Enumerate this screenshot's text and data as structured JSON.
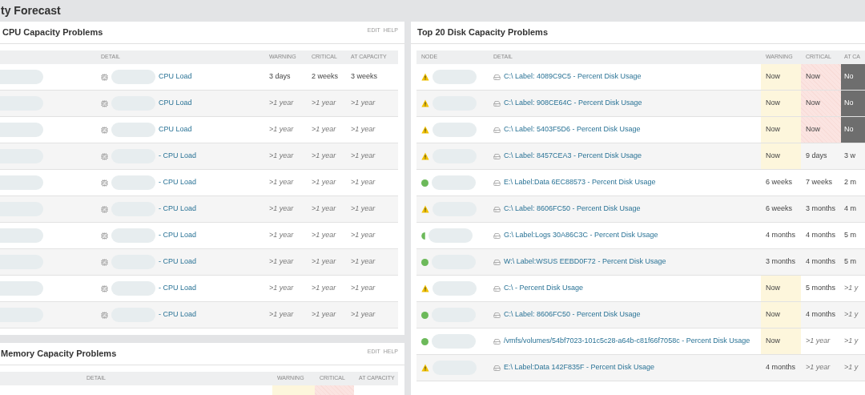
{
  "page_title": "ty Forecast",
  "cpu_panel": {
    "title": "CPU Capacity Problems",
    "actions": [
      "EDIT",
      "HELP"
    ],
    "columns": [
      "DETAIL",
      "WARNING",
      "CRITICAL",
      "AT CAPACITY"
    ],
    "rows": [
      {
        "cells": [
          {
            "text": "CPU Load"
          },
          {
            "text": "3 days",
            "flagged": false,
            "italic": false
          },
          {
            "text": "2 weeks",
            "flagged": false,
            "italic": false
          },
          {
            "text": "3 weeks",
            "flagged": false,
            "italic": false
          }
        ]
      },
      {
        "cells": [
          {
            "text": "CPU Load"
          },
          {
            "text": ">1 year",
            "flagged": false,
            "italic": true
          },
          {
            "text": ">1 year",
            "flagged": false,
            "italic": true
          },
          {
            "text": ">1 year",
            "flagged": false,
            "italic": true
          }
        ]
      },
      {
        "cells": [
          {
            "text": "CPU Load"
          },
          {
            "text": ">1 year",
            "flagged": false,
            "italic": true
          },
          {
            "text": ">1 year",
            "flagged": false,
            "italic": true
          },
          {
            "text": ">1 year",
            "flagged": false,
            "italic": true
          }
        ]
      },
      {
        "cells": [
          {
            "text": "- CPU Load"
          },
          {
            "text": ">1 year",
            "flagged": false,
            "italic": true
          },
          {
            "text": ">1 year",
            "flagged": false,
            "italic": true
          },
          {
            "text": ">1 year",
            "flagged": false,
            "italic": true
          }
        ]
      },
      {
        "cells": [
          {
            "text": "- CPU Load"
          },
          {
            "text": ">1 year",
            "flagged": false,
            "italic": true
          },
          {
            "text": ">1 year",
            "flagged": false,
            "italic": true
          },
          {
            "text": ">1 year",
            "flagged": false,
            "italic": true
          }
        ]
      },
      {
        "cells": [
          {
            "text": "- CPU Load"
          },
          {
            "text": ">1 year",
            "flagged": false,
            "italic": true
          },
          {
            "text": ">1 year",
            "flagged": false,
            "italic": true
          },
          {
            "text": ">1 year",
            "flagged": false,
            "italic": true
          }
        ]
      },
      {
        "cells": [
          {
            "text": "- CPU Load"
          },
          {
            "text": ">1 year",
            "flagged": false,
            "italic": true
          },
          {
            "text": ">1 year",
            "flagged": false,
            "italic": true
          },
          {
            "text": ">1 year",
            "flagged": false,
            "italic": true
          }
        ]
      },
      {
        "cells": [
          {
            "text": "- CPU Load"
          },
          {
            "text": ">1 year",
            "flagged": false,
            "italic": true
          },
          {
            "text": ">1 year",
            "flagged": false,
            "italic": true
          },
          {
            "text": ">1 year",
            "flagged": false,
            "italic": true
          }
        ]
      },
      {
        "cells": [
          {
            "text": "- CPU Load"
          },
          {
            "text": ">1 year",
            "flagged": false,
            "italic": true
          },
          {
            "text": ">1 year",
            "flagged": false,
            "italic": true
          },
          {
            "text": ">1 year",
            "flagged": false,
            "italic": true
          }
        ]
      },
      {
        "cells": [
          {
            "text": "- CPU Load"
          },
          {
            "text": ">1 year",
            "flagged": false,
            "italic": true
          },
          {
            "text": ">1 year",
            "flagged": false,
            "italic": true
          },
          {
            "text": ">1 year",
            "flagged": false,
            "italic": true
          }
        ]
      }
    ]
  },
  "memory_panel": {
    "title": "Memory Capacity Problems",
    "actions": [
      "EDIT",
      "HELP"
    ],
    "columns": [
      "DETAIL",
      "WARNING",
      "CRITICAL",
      "AT CAPACITY"
    ],
    "rows": [
      {
        "cells": [
          {
            "flagged": true
          },
          {
            "flagged": true
          },
          {
            "flagged": false
          }
        ]
      }
    ]
  },
  "disk_panel": {
    "title": "Top 20 Disk Capacity Problems",
    "columns": [
      "NODE",
      "DETAIL",
      "WARNING",
      "CRITICAL",
      "AT CA"
    ],
    "rows": [
      {
        "cells": [
          {
            "kind": "warning"
          },
          {
            "text": "C:\\ Label: 4089C9C5 - Percent Disk Usage"
          },
          {
            "text": "Now",
            "flagged": true,
            "italic": false
          },
          {
            "text": "Now",
            "flagged": true,
            "italic": false
          },
          {
            "text": "No",
            "flagged": true,
            "italic": false
          }
        ]
      },
      {
        "cells": [
          {
            "kind": "warning"
          },
          {
            "text": "C:\\ Label: 908CE64C - Percent Disk Usage"
          },
          {
            "text": "Now",
            "flagged": true,
            "italic": false
          },
          {
            "text": "Now",
            "flagged": true,
            "italic": false
          },
          {
            "text": "No",
            "flagged": true,
            "italic": false
          }
        ]
      },
      {
        "cells": [
          {
            "kind": "warning"
          },
          {
            "text": "C:\\ Label: 5403F5D6 - Percent Disk Usage"
          },
          {
            "text": "Now",
            "flagged": true,
            "italic": false
          },
          {
            "text": "Now",
            "flagged": true,
            "italic": false
          },
          {
            "text": "No",
            "flagged": true,
            "italic": false
          }
        ]
      },
      {
        "cells": [
          {
            "kind": "warning"
          },
          {
            "text": "C:\\ Label: 8457CEA3 - Percent Disk Usage"
          },
          {
            "text": "Now",
            "flagged": true,
            "italic": false
          },
          {
            "text": "9 days",
            "flagged": false,
            "italic": false
          },
          {
            "text": "3 w",
            "flagged": false,
            "italic": false
          }
        ]
      },
      {
        "cells": [
          {
            "kind": "up"
          },
          {
            "text": "E:\\ Label:Data 6EC88573 - Percent Disk Usage"
          },
          {
            "text": "6 weeks",
            "flagged": false,
            "italic": false
          },
          {
            "text": "7 weeks",
            "flagged": false,
            "italic": false
          },
          {
            "text": "2 m",
            "flagged": false,
            "italic": false
          }
        ]
      },
      {
        "cells": [
          {
            "kind": "warning"
          },
          {
            "text": "C:\\ Label: 8606FC50 - Percent Disk Usage"
          },
          {
            "text": "6 weeks",
            "flagged": false,
            "italic": false
          },
          {
            "text": "3 months",
            "flagged": false,
            "italic": false
          },
          {
            "text": "4 m",
            "flagged": false,
            "italic": false
          }
        ]
      },
      {
        "cells": [
          {
            "kind": "partial"
          },
          {
            "text": "G:\\ Label:Logs 30A86C3C - Percent Disk Usage"
          },
          {
            "text": "4 months",
            "flagged": false,
            "italic": false
          },
          {
            "text": "4 months",
            "flagged": false,
            "italic": false
          },
          {
            "text": "5 m",
            "flagged": false,
            "italic": false
          }
        ]
      },
      {
        "cells": [
          {
            "kind": "up"
          },
          {
            "text": "W:\\ Label:WSUS EEBD0F72 - Percent Disk Usage"
          },
          {
            "text": "3 months",
            "flagged": false,
            "italic": false
          },
          {
            "text": "4 months",
            "flagged": false,
            "italic": false
          },
          {
            "text": "5 m",
            "flagged": false,
            "italic": false
          }
        ]
      },
      {
        "cells": [
          {
            "kind": "warning"
          },
          {
            "text": "C:\\ - Percent Disk Usage"
          },
          {
            "text": "Now",
            "flagged": true,
            "italic": false
          },
          {
            "text": "5 months",
            "flagged": false,
            "italic": false
          },
          {
            "text": ">1 y",
            "flagged": false,
            "italic": true
          }
        ]
      },
      {
        "cells": [
          {
            "kind": "up"
          },
          {
            "text": "C:\\ Label: 8606FC50 - Percent Disk Usage"
          },
          {
            "text": "Now",
            "flagged": true,
            "italic": false
          },
          {
            "text": "4 months",
            "flagged": false,
            "italic": false
          },
          {
            "text": ">1 y",
            "flagged": false,
            "italic": true
          }
        ]
      },
      {
        "cells": [
          {
            "kind": "up"
          },
          {
            "text": "/vmfs/volumes/54bf7023-101c5c28-a64b-c81f66f7058c - Percent Disk Usage"
          },
          {
            "text": "Now",
            "flagged": true,
            "italic": false
          },
          {
            "text": ">1 year",
            "flagged": false,
            "italic": true
          },
          {
            "text": ">1 y",
            "flagged": false,
            "italic": true
          }
        ]
      },
      {
        "cells": [
          {
            "kind": "warning"
          },
          {
            "text": "E:\\ Label:Data 142F835F - Percent Disk Usage"
          },
          {
            "text": "4 months",
            "flagged": false,
            "italic": false
          },
          {
            "text": ">1 year",
            "flagged": false,
            "italic": true
          },
          {
            "text": ">1 y",
            "flagged": false,
            "italic": true
          }
        ]
      }
    ]
  }
}
